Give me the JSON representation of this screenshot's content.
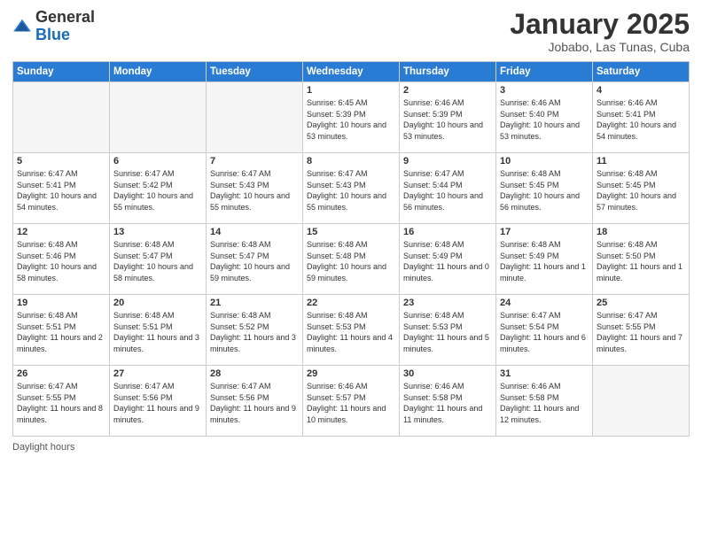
{
  "header": {
    "logo_general": "General",
    "logo_blue": "Blue",
    "month_title": "January 2025",
    "location": "Jobabo, Las Tunas, Cuba"
  },
  "days_of_week": [
    "Sunday",
    "Monday",
    "Tuesday",
    "Wednesday",
    "Thursday",
    "Friday",
    "Saturday"
  ],
  "weeks": [
    [
      {
        "day": "",
        "empty": true
      },
      {
        "day": "",
        "empty": true
      },
      {
        "day": "",
        "empty": true
      },
      {
        "day": "1",
        "sunrise": "6:45 AM",
        "sunset": "5:39 PM",
        "daylight": "10 hours and 53 minutes."
      },
      {
        "day": "2",
        "sunrise": "6:46 AM",
        "sunset": "5:39 PM",
        "daylight": "10 hours and 53 minutes."
      },
      {
        "day": "3",
        "sunrise": "6:46 AM",
        "sunset": "5:40 PM",
        "daylight": "10 hours and 53 minutes."
      },
      {
        "day": "4",
        "sunrise": "6:46 AM",
        "sunset": "5:41 PM",
        "daylight": "10 hours and 54 minutes."
      }
    ],
    [
      {
        "day": "5",
        "sunrise": "6:47 AM",
        "sunset": "5:41 PM",
        "daylight": "10 hours and 54 minutes."
      },
      {
        "day": "6",
        "sunrise": "6:47 AM",
        "sunset": "5:42 PM",
        "daylight": "10 hours and 55 minutes."
      },
      {
        "day": "7",
        "sunrise": "6:47 AM",
        "sunset": "5:43 PM",
        "daylight": "10 hours and 55 minutes."
      },
      {
        "day": "8",
        "sunrise": "6:47 AM",
        "sunset": "5:43 PM",
        "daylight": "10 hours and 55 minutes."
      },
      {
        "day": "9",
        "sunrise": "6:47 AM",
        "sunset": "5:44 PM",
        "daylight": "10 hours and 56 minutes."
      },
      {
        "day": "10",
        "sunrise": "6:48 AM",
        "sunset": "5:45 PM",
        "daylight": "10 hours and 56 minutes."
      },
      {
        "day": "11",
        "sunrise": "6:48 AM",
        "sunset": "5:45 PM",
        "daylight": "10 hours and 57 minutes."
      }
    ],
    [
      {
        "day": "12",
        "sunrise": "6:48 AM",
        "sunset": "5:46 PM",
        "daylight": "10 hours and 58 minutes."
      },
      {
        "day": "13",
        "sunrise": "6:48 AM",
        "sunset": "5:47 PM",
        "daylight": "10 hours and 58 minutes."
      },
      {
        "day": "14",
        "sunrise": "6:48 AM",
        "sunset": "5:47 PM",
        "daylight": "10 hours and 59 minutes."
      },
      {
        "day": "15",
        "sunrise": "6:48 AM",
        "sunset": "5:48 PM",
        "daylight": "10 hours and 59 minutes."
      },
      {
        "day": "16",
        "sunrise": "6:48 AM",
        "sunset": "5:49 PM",
        "daylight": "11 hours and 0 minutes."
      },
      {
        "day": "17",
        "sunrise": "6:48 AM",
        "sunset": "5:49 PM",
        "daylight": "11 hours and 1 minute."
      },
      {
        "day": "18",
        "sunrise": "6:48 AM",
        "sunset": "5:50 PM",
        "daylight": "11 hours and 1 minute."
      }
    ],
    [
      {
        "day": "19",
        "sunrise": "6:48 AM",
        "sunset": "5:51 PM",
        "daylight": "11 hours and 2 minutes."
      },
      {
        "day": "20",
        "sunrise": "6:48 AM",
        "sunset": "5:51 PM",
        "daylight": "11 hours and 3 minutes."
      },
      {
        "day": "21",
        "sunrise": "6:48 AM",
        "sunset": "5:52 PM",
        "daylight": "11 hours and 3 minutes."
      },
      {
        "day": "22",
        "sunrise": "6:48 AM",
        "sunset": "5:53 PM",
        "daylight": "11 hours and 4 minutes."
      },
      {
        "day": "23",
        "sunrise": "6:48 AM",
        "sunset": "5:53 PM",
        "daylight": "11 hours and 5 minutes."
      },
      {
        "day": "24",
        "sunrise": "6:47 AM",
        "sunset": "5:54 PM",
        "daylight": "11 hours and 6 minutes."
      },
      {
        "day": "25",
        "sunrise": "6:47 AM",
        "sunset": "5:55 PM",
        "daylight": "11 hours and 7 minutes."
      }
    ],
    [
      {
        "day": "26",
        "sunrise": "6:47 AM",
        "sunset": "5:55 PM",
        "daylight": "11 hours and 8 minutes."
      },
      {
        "day": "27",
        "sunrise": "6:47 AM",
        "sunset": "5:56 PM",
        "daylight": "11 hours and 9 minutes."
      },
      {
        "day": "28",
        "sunrise": "6:47 AM",
        "sunset": "5:56 PM",
        "daylight": "11 hours and 9 minutes."
      },
      {
        "day": "29",
        "sunrise": "6:46 AM",
        "sunset": "5:57 PM",
        "daylight": "11 hours and 10 minutes."
      },
      {
        "day": "30",
        "sunrise": "6:46 AM",
        "sunset": "5:58 PM",
        "daylight": "11 hours and 11 minutes."
      },
      {
        "day": "31",
        "sunrise": "6:46 AM",
        "sunset": "5:58 PM",
        "daylight": "11 hours and 12 minutes."
      },
      {
        "day": "",
        "empty": true
      }
    ]
  ],
  "footer": {
    "daylight_label": "Daylight hours"
  }
}
